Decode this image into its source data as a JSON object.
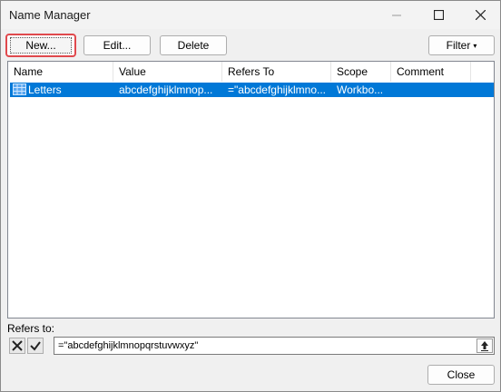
{
  "window": {
    "title": "Name Manager",
    "controls": {
      "minimize_icon": "minimize-icon",
      "maximize_icon": "maximize-icon",
      "close_icon": "close-icon"
    }
  },
  "toolbar": {
    "new_label": "New...",
    "edit_label": "Edit...",
    "delete_label": "Delete",
    "filter_label": "Filter",
    "filter_caret": "▾"
  },
  "list": {
    "columns": [
      "Name",
      "Value",
      "Refers To",
      "Scope",
      "Comment"
    ],
    "rows": [
      {
        "icon": "named-range-icon",
        "name": "Letters",
        "value": "abcdefghijklmnop...",
        "refers_to": "=\"abcdefghijklmno...",
        "scope": "Workbo...",
        "comment": ""
      }
    ],
    "selected_row_color": "#0078d7"
  },
  "refers": {
    "label": "Refers to:",
    "value": "=\"abcdefghijklmnopqrstuvwxyz\"",
    "cancel_icon": "cancel-x-icon",
    "confirm_icon": "checkmark-icon",
    "collapse_icon": "collapse-dialog-icon"
  },
  "footer": {
    "close_label": "Close"
  },
  "colors": {
    "highlight_border": "#e0494d",
    "accent": "#0078d7"
  }
}
